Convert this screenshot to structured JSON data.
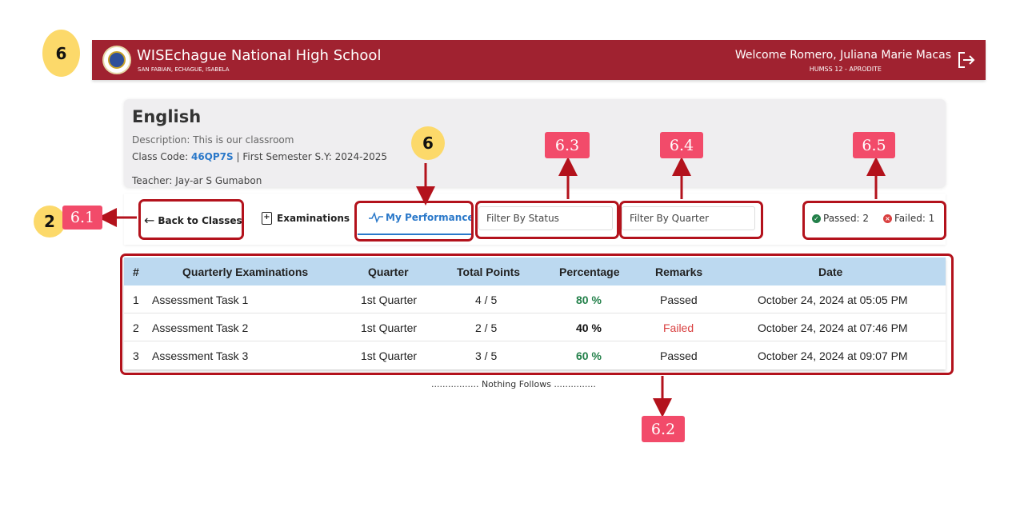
{
  "markers": {
    "top_left": "6",
    "my_performance": "6",
    "back": "2",
    "labels": [
      "6.1",
      "6.2",
      "6.3",
      "6.4",
      "6.5"
    ]
  },
  "header": {
    "school_name": "WISEchague National High School",
    "school_sub": "SAN FABIAN, ECHAGUE, ISABELA",
    "welcome": "Welcome Romero, Juliana Marie Macas",
    "section": "HUMSS 12 - APRODITE",
    "logout_icon": "logout-icon",
    "bg_color": "#a02230"
  },
  "card": {
    "title": "English",
    "description": "Description: This is our classroom",
    "class_code_prefix": "Class Code: ",
    "class_code": "46QP7S",
    "semester": " | First Semester S.Y: 2024-2025",
    "teacher": "Teacher: Jay-ar S Gumabon"
  },
  "toolbar": {
    "back": "Back to Classes",
    "examinations": "Examinations",
    "my_performance": "My Performance",
    "filter_status": "Filter By Status",
    "filter_quarter": "Filter By Quarter",
    "passed": "Passed: 2",
    "failed": "Failed: 1",
    "accent": "#2a78c9"
  },
  "table": {
    "headers": [
      "#",
      "Quarterly Examinations",
      "Quarter",
      "Total Points",
      "Percentage",
      "Remarks",
      "Date"
    ],
    "rows": [
      {
        "num": "1",
        "exam": "Assessment Task 1",
        "quarter": "1st Quarter",
        "points": "4 / 5",
        "percentage": "80 %",
        "remarks": "Passed",
        "date": "October 24, 2024 at 05:05 PM"
      },
      {
        "num": "2",
        "exam": "Assessment Task 2",
        "quarter": "1st Quarter",
        "points": "2 / 5",
        "percentage": "40 %",
        "remarks": "Failed",
        "date": "October 24, 2024 at 07:46 PM"
      },
      {
        "num": "3",
        "exam": "Assessment Task 3",
        "quarter": "1st Quarter",
        "points": "3 / 5",
        "percentage": "60 %",
        "remarks": "Passed",
        "date": "October 24, 2024 at 09:07 PM"
      }
    ]
  },
  "footer": {
    "nothing_follows": "................. Nothing Follows ..............."
  }
}
